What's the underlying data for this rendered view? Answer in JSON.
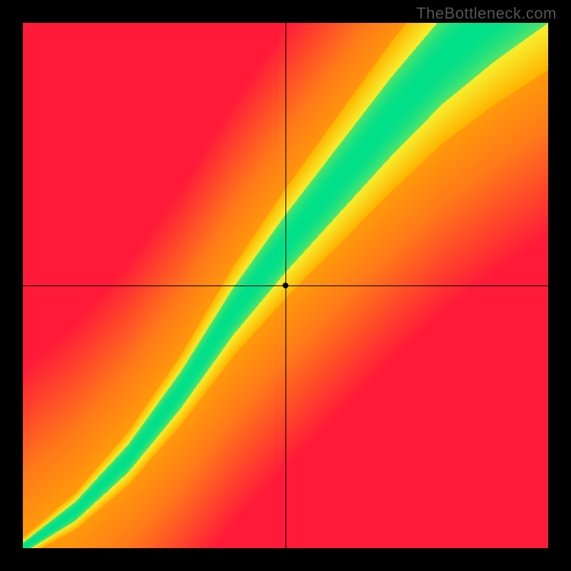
{
  "watermark": "TheBottleneck.com",
  "chart_data": {
    "type": "heatmap",
    "title": "",
    "xlabel": "",
    "ylabel": "",
    "xlim": [
      0,
      1
    ],
    "ylim": [
      0,
      1
    ],
    "crosshair": {
      "x": 0.5,
      "y": 0.5
    },
    "marker": {
      "x": 0.5,
      "y": 0.5
    },
    "ridge_control_points": [
      {
        "x": 0.0,
        "y": 0.0
      },
      {
        "x": 0.1,
        "y": 0.07
      },
      {
        "x": 0.2,
        "y": 0.17
      },
      {
        "x": 0.3,
        "y": 0.3
      },
      {
        "x": 0.4,
        "y": 0.45
      },
      {
        "x": 0.5,
        "y": 0.58
      },
      {
        "x": 0.6,
        "y": 0.7
      },
      {
        "x": 0.7,
        "y": 0.82
      },
      {
        "x": 0.8,
        "y": 0.93
      },
      {
        "x": 0.9,
        "y": 1.02
      },
      {
        "x": 1.0,
        "y": 1.1
      }
    ],
    "band_half_width_at": [
      {
        "x": 0.0,
        "w": 0.01
      },
      {
        "x": 0.3,
        "w": 0.035
      },
      {
        "x": 0.5,
        "w": 0.055
      },
      {
        "x": 0.7,
        "w": 0.075
      },
      {
        "x": 1.0,
        "w": 0.1
      }
    ],
    "halo_half_width_multiplier": 1.9,
    "colors": {
      "ridge": "#00e08a",
      "halo": "#f7ef2e",
      "top_left": "#ff1a3a",
      "bottom_right": "#ff1a3a",
      "near_ridge_warm": "#ffb300",
      "mid_warm": "#ff7a1a"
    },
    "description": "Heatmap over a unit square. A green ridge runs roughly diagonally from bottom-left to upper-middle-right following a mildly S-shaped curve. The ridge is surrounded by a yellow halo which fades into orange then red towards the far corners (upper-left and lower-right are the reddest). Black crosshair lines intersect near the center with a small black dot where they cross."
  }
}
